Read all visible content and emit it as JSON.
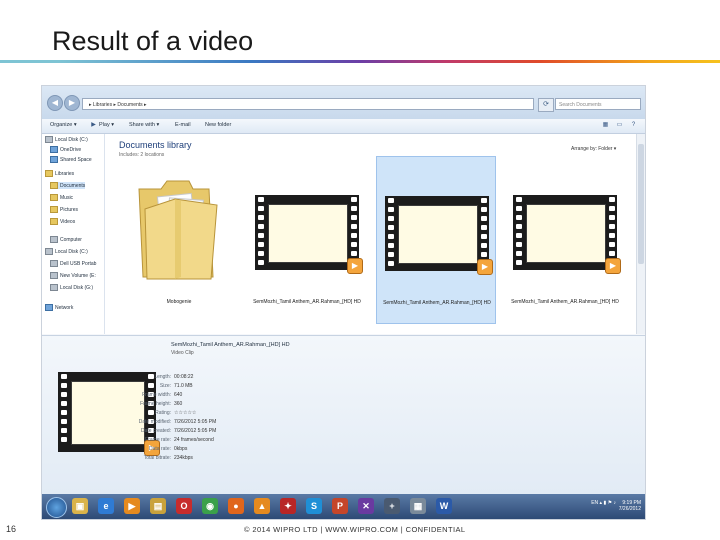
{
  "slide": {
    "title": "Result of a video",
    "page_number": "16",
    "footer": "© 2014 WIPRO LTD | WWW.WIPRO.COM | CONFIDENTIAL"
  },
  "explorer": {
    "breadcrumb": "▸ Libraries ▸ Documents ▸",
    "search_placeholder": "Search Documents",
    "toolbar": {
      "organize": "Organize ▾",
      "play": "Play ▾",
      "share_with": "Share with ▾",
      "email": "E-mail",
      "new_folder": "New folder"
    },
    "nav": [
      {
        "label": "Local Disk (C:)",
        "icon": "drive"
      },
      {
        "label": "OneDrive",
        "icon": "blue"
      },
      {
        "label": "Shared Space",
        "icon": "blue"
      },
      {
        "label": "Libraries",
        "icon": "folder"
      },
      {
        "label": "Documents",
        "icon": "folder"
      },
      {
        "label": "Music",
        "icon": "folder"
      },
      {
        "label": "Pictures",
        "icon": "folder"
      },
      {
        "label": "Videos",
        "icon": "folder"
      },
      {
        "label": "Computer",
        "icon": "drive"
      },
      {
        "label": "Local Disk (C:)",
        "icon": "drive"
      },
      {
        "label": "Dell USB Portab",
        "icon": "drive"
      },
      {
        "label": "New Volume (E:",
        "icon": "drive"
      },
      {
        "label": "Local Disk (G:)",
        "icon": "drive"
      },
      {
        "label": "Network",
        "icon": "blue"
      }
    ],
    "library_title": "Documents library",
    "library_subtitle": "Includes: 2 locations",
    "arrange_by": "Arrange by: Folder ▾",
    "items": [
      {
        "label": "Mobogenie",
        "kind": "folder"
      },
      {
        "label": "SemMozhi_Tamil Anthem_AR.Rahman_[HD] HD",
        "kind": "video"
      },
      {
        "label": "SemMozhi_Tamil Anthem_AR.Rahman_[HD] HD",
        "kind": "video"
      },
      {
        "label": "SemMozhi_Tamil Anthem_AR.Rahman_[HD] HD",
        "kind": "video"
      }
    ],
    "details": {
      "name": "SemMozhi_Tamil Anthem_AR.Rahman_[HD] HD",
      "type": "Video Clip",
      "rows": [
        {
          "key": "Length:",
          "value": "00:08:22"
        },
        {
          "key": "Size:",
          "value": "71.0 MB"
        },
        {
          "key": "Frame width:",
          "value": "640"
        },
        {
          "key": "Frame height:",
          "value": "360"
        },
        {
          "key": "Rating:",
          "value": "☆☆☆☆☆"
        },
        {
          "key": "Date modified:",
          "value": "7/26/2012 5:05 PM"
        },
        {
          "key": "Date created:",
          "value": "7/26/2012 5:05 PM"
        },
        {
          "key": "Frame rate:",
          "value": "24 frames/second"
        },
        {
          "key": "Data rate:",
          "value": "0kbps"
        },
        {
          "key": "Total bitrate:",
          "value": "234kbps"
        }
      ]
    },
    "taskbar": {
      "clock_time": "9:19 PM",
      "clock_date": "7/26/2012",
      "tray_text": "EN ▴ ▮ ⚑ ♪",
      "apps": [
        {
          "name": "explorer-app",
          "glyph": "▣",
          "color": "#d9b34a"
        },
        {
          "name": "ie-app",
          "glyph": "e",
          "color": "#2f7bd4"
        },
        {
          "name": "media-app",
          "glyph": "▶",
          "color": "#e58a1f"
        },
        {
          "name": "files-app",
          "glyph": "▤",
          "color": "#c9a23c"
        },
        {
          "name": "opera-app",
          "glyph": "O",
          "color": "#c72c2c"
        },
        {
          "name": "chrome-app",
          "glyph": "◉",
          "color": "#3aa04a"
        },
        {
          "name": "firefox-app",
          "glyph": "●",
          "color": "#e0661d"
        },
        {
          "name": "vlc-app",
          "glyph": "▲",
          "color": "#e58a1f"
        },
        {
          "name": "pdf-app",
          "glyph": "✦",
          "color": "#b82626"
        },
        {
          "name": "skype-app",
          "glyph": "S",
          "color": "#1f8fd6"
        },
        {
          "name": "ppt-app",
          "glyph": "P",
          "color": "#c5462a"
        },
        {
          "name": "editor-app",
          "glyph": "✕",
          "color": "#6a3aa0"
        },
        {
          "name": "tool-app",
          "glyph": "+",
          "color": "#4a5a70"
        },
        {
          "name": "box-app",
          "glyph": "▦",
          "color": "#7a8a9a"
        },
        {
          "name": "word-app",
          "glyph": "W",
          "color": "#2b5aa8"
        }
      ]
    }
  }
}
